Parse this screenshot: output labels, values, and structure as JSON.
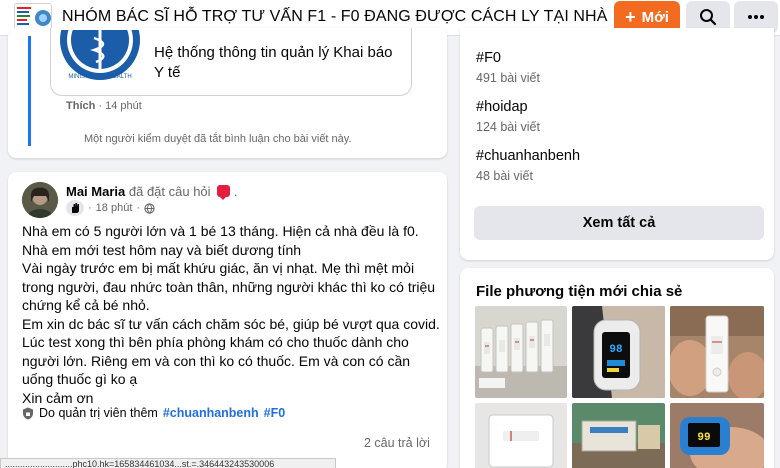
{
  "header": {
    "group_title": "NHÓM BÁC SĨ HỖ TRỢ TƯ VẤN F1 - F0 ĐANG ĐƯỢC CÁCH LY TẠI NHÀ",
    "new_button": "Mới",
    "new_button_icon": "plus-icon",
    "search_icon": "search-icon",
    "more_icon": "more-icon"
  },
  "shared_link": {
    "title": "Hệ thống thông tin quản lý Khai báo Y tế",
    "seal_text": "MINISTRY OF HEALTH",
    "like_label": "Thích",
    "time": "14 phút"
  },
  "moderation_note": "Một người kiểm duyệt đã tắt bình luận cho bài viết này.",
  "post": {
    "author": "Mai Maria",
    "action": "đã đặt câu hỏi",
    "time": "18 phút",
    "body": [
      "Nhà em có 5 người lớn và 1 bé 13 tháng. Hiện cả nhà đều là f0. Nhà em mới test hôm nay và biết dương tính",
      "Vài ngày trước em bị mất khứu giác, ăn vị nhạt. Mẹ thì mệt mỏi trong người, đau nhức toàn thân, những người khác thì ko có triệu chứng kể cả bé nhỏ.",
      "Em xin dc bác sĩ tư vấn cách chăm sóc bé, giúp bé vượt qua covid. Lúc test xong thì bên phía phòng khám có cho thuốc dành cho người lớn. Riêng em và con thì ko có thuốc. Em và con có cần uống thuốc gì ko ạ",
      "Xin cảm ơn"
    ],
    "admin_label": "Do quản trị viên thêm",
    "tags": [
      "#chuanhanbenh",
      "#F0"
    ],
    "replies": "2 câu trả lời"
  },
  "status_url": "...........................phc10.hk=165834461034...st.=.346443243530006",
  "topics": {
    "items": [
      {
        "name": "#F0",
        "count": "491 bài viết"
      },
      {
        "name": "#hoidap",
        "count": "124 bài viết"
      },
      {
        "name": "#chuanhanbenh",
        "count": "48 bài viết"
      }
    ],
    "see_all": "Xem tất cả"
  },
  "media": {
    "title": "File phương tiện mới chia sẻ",
    "oximeter_reading": "98",
    "oximeter_reading_2": "99"
  },
  "colors": {
    "accent": "#f26b21",
    "link": "#216fdb",
    "quote_bar": "#1877f2",
    "question_badge": "#e41e3f"
  }
}
